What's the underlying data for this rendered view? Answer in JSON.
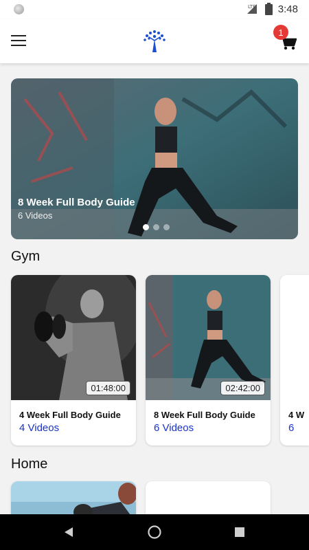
{
  "status": {
    "time": "3:48",
    "network": "LTE"
  },
  "header": {
    "cart_count": "1"
  },
  "hero": {
    "title": "8 Week Full Body Guide",
    "subtitle": "6 Videos",
    "page_count": 3,
    "active_page": 1
  },
  "sections": [
    {
      "title": "Gym",
      "cards": [
        {
          "duration": "01:48:00",
          "title": "4 Week Full Body Guide",
          "subtitle": "4 Videos"
        },
        {
          "duration": "02:42:00",
          "title": "8 Week Full Body Guide",
          "subtitle": "6 Videos"
        },
        {
          "title": "4 W",
          "subtitle": "6"
        }
      ]
    },
    {
      "title": "Home"
    }
  ],
  "colors": {
    "accent": "#1a33c7",
    "badge": "#e53935",
    "logo": "#1a4fd1"
  }
}
